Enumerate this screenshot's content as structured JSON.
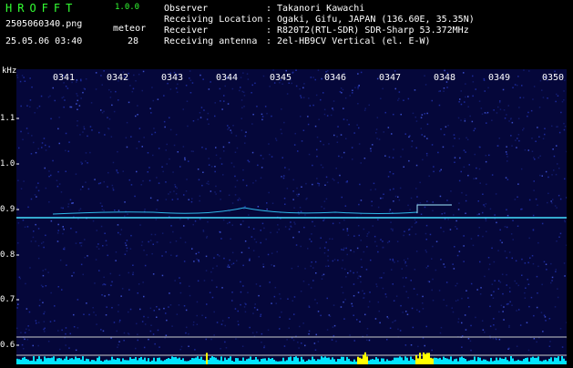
{
  "app": {
    "title": "HROFFT",
    "version": "1.0.0"
  },
  "capture": {
    "filename": "2505060340.png",
    "datetime": "25.05.06 03:40"
  },
  "meteor": {
    "label": "meteor",
    "count": "28"
  },
  "info": [
    {
      "key": "Observer",
      "value": "Takanori Kawachi"
    },
    {
      "key": "Receiving Location",
      "value": "Ogaki, Gifu, JAPAN (136.60E, 35.35N)"
    },
    {
      "key": "Receiver",
      "value": "R820T2(RTL-SDR) SDR-Sharp 53.372MHz"
    },
    {
      "key": "Receiving antenna",
      "value": "2el-HB9CV Vertical (el. E-W)"
    }
  ],
  "y_axis": {
    "unit": "kHz",
    "ticks": [
      "1.1",
      "1.0",
      "0.9",
      "0.8",
      "0.7",
      "0.6"
    ]
  },
  "x_axis": {
    "ticks": [
      "0341",
      "0342",
      "0343",
      "0344",
      "0345",
      "0346",
      "0347",
      "0348",
      "0349",
      "0350"
    ]
  },
  "colors": {
    "title": "#33ff33",
    "background": "#05073a",
    "carrier": "#44e0ff",
    "level": "#00e5ff",
    "level_peak": "#ffff00"
  }
}
